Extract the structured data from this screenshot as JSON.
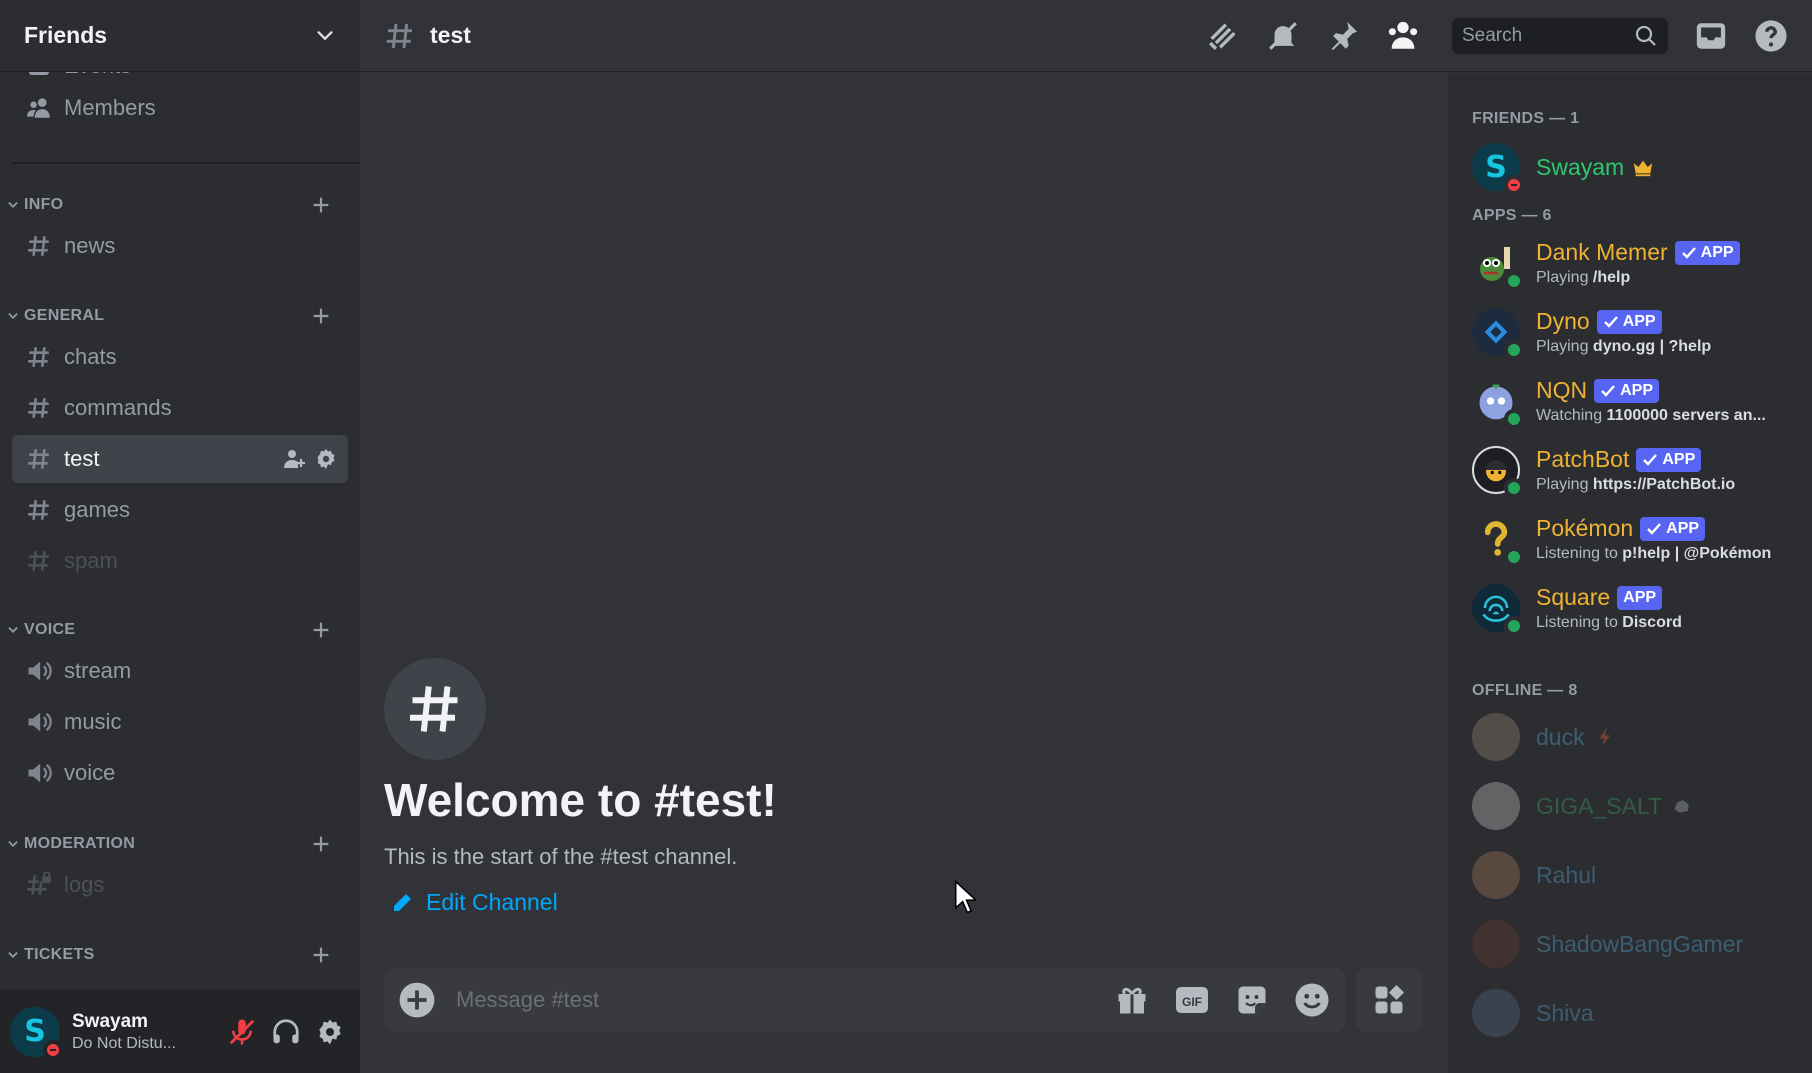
{
  "server": {
    "name": "Friends"
  },
  "sidebar": {
    "top_items": [
      {
        "label": "Events",
        "icon": "calendar-icon"
      },
      {
        "label": "Members",
        "icon": "members-icon"
      }
    ],
    "categories": [
      {
        "label": "INFO",
        "channels": [
          {
            "label": "news",
            "type": "text"
          }
        ]
      },
      {
        "label": "GENERAL",
        "channels": [
          {
            "label": "chats",
            "type": "text"
          },
          {
            "label": "commands",
            "type": "text"
          },
          {
            "label": "test",
            "type": "text",
            "selected": true
          },
          {
            "label": "games",
            "type": "text"
          },
          {
            "label": "spam",
            "type": "text",
            "muted": true
          }
        ]
      },
      {
        "label": "VOICE",
        "channels": [
          {
            "label": "stream",
            "type": "voice"
          },
          {
            "label": "music",
            "type": "voice"
          },
          {
            "label": "voice",
            "type": "voice"
          }
        ]
      },
      {
        "label": "MODERATION",
        "channels": [
          {
            "label": "logs",
            "type": "locked-text",
            "muted": true
          }
        ]
      },
      {
        "label": "TICKETS",
        "channels": []
      }
    ]
  },
  "user_panel": {
    "username": "Swayam",
    "status": "Do Not Distu...",
    "avatar_letter": "S"
  },
  "topbar": {
    "channel_name": "test",
    "search_placeholder": "Search"
  },
  "chat": {
    "welcome_title": "Welcome to #test!",
    "welcome_subtitle": "This is the start of the #test channel.",
    "edit_channel_label": "Edit Channel",
    "composer_placeholder": "Message #test",
    "gif_label": "GIF"
  },
  "members": {
    "friends_title": "FRIENDS — 1",
    "apps_title": "APPS — 6",
    "offline_title": "OFFLINE — 8",
    "friends": [
      {
        "name": "Swayam",
        "status": "dnd",
        "avatar_letter": "S"
      }
    ],
    "apps": [
      {
        "name": "Dank Memer",
        "badge": "APP",
        "verified": true,
        "activity_prefix": "Playing ",
        "activity": "/help"
      },
      {
        "name": "Dyno",
        "badge": "APP",
        "verified": true,
        "activity_prefix": "Playing ",
        "activity": "dyno.gg | ?help"
      },
      {
        "name": "NQN",
        "badge": "APP",
        "verified": true,
        "activity_prefix": "Watching ",
        "activity": "1100000 servers an..."
      },
      {
        "name": "PatchBot",
        "badge": "APP",
        "verified": true,
        "activity_prefix": "Playing ",
        "activity": "https://PatchBot.io"
      },
      {
        "name": "Pokémon",
        "badge": "APP",
        "verified": true,
        "activity_prefix": "Listening to ",
        "activity": "p!help | @Pokémon"
      },
      {
        "name": "Square",
        "badge": "APP",
        "verified": false,
        "activity_prefix": "Listening to ",
        "activity": "Discord"
      }
    ],
    "offline": [
      {
        "name": "duck"
      },
      {
        "name": "GIGA_SALT"
      },
      {
        "name": "Rahul"
      },
      {
        "name": "ShadowBangGamer"
      },
      {
        "name": "Shiva"
      }
    ]
  },
  "colors": {
    "accent": "#5865f2",
    "link": "#00a8fc",
    "bot_name": "#f0b232",
    "friend_name": "#2dc770",
    "dnd": "#f23f43",
    "online": "#23a55a"
  }
}
